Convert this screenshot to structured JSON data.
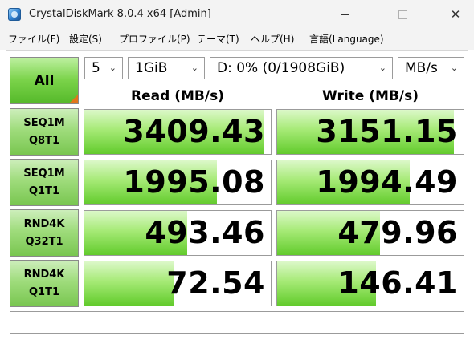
{
  "window": {
    "title": "CrystalDiskMark 8.0.4 x64 [Admin]"
  },
  "menu": [
    "ファイル(F)",
    "設定(S)",
    "プロファイル(P)",
    "テーマ(T)",
    "ヘルプ(H)",
    "言語(Language)"
  ],
  "controls": {
    "all_label": "All",
    "count": "5",
    "size": "1GiB",
    "drive": "D: 0% (0/1908GiB)",
    "unit": "MB/s"
  },
  "headers": {
    "read": "Read (MB/s)",
    "write": "Write (MB/s)"
  },
  "tests": [
    {
      "line1": "SEQ1M",
      "line2": "Q8T1",
      "read": "3409.43",
      "write": "3151.15",
      "read_fill": 0.96,
      "write_fill": 0.95
    },
    {
      "line1": "SEQ1M",
      "line2": "Q1T1",
      "read": "1995.08",
      "write": "1994.49",
      "read_fill": 0.71,
      "write_fill": 0.71
    },
    {
      "line1": "RND4K",
      "line2": "Q32T1",
      "read": "493.46",
      "write": "479.96",
      "read_fill": 0.55,
      "write_fill": 0.55
    },
    {
      "line1": "RND4K",
      "line2": "Q1T1",
      "read": "72.54",
      "write": "146.41",
      "read_fill": 0.48,
      "write_fill": 0.53
    }
  ],
  "comment": ""
}
